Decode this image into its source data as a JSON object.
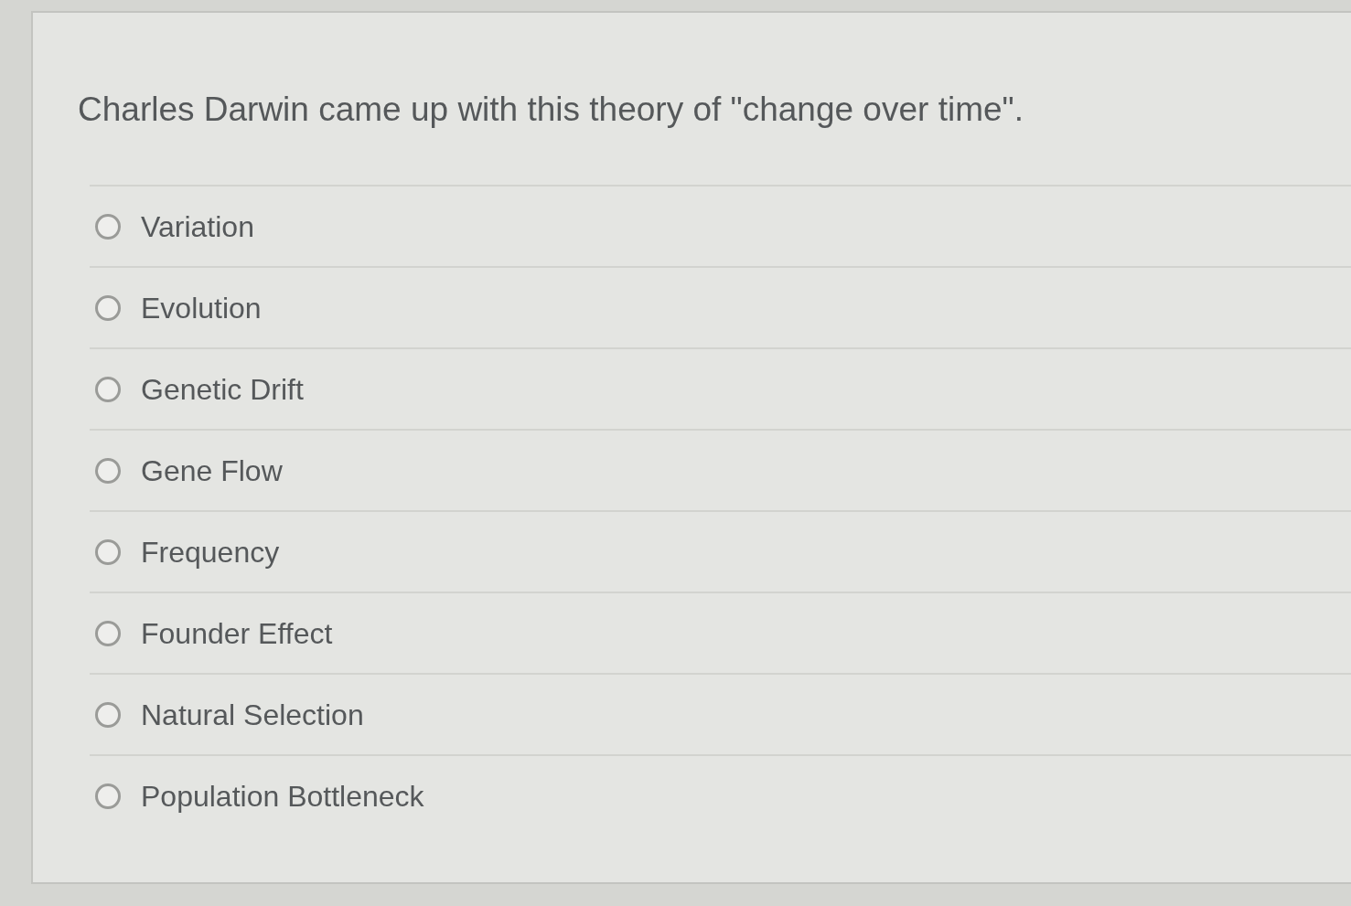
{
  "question": "Charles Darwin came up with this theory of \"change over time\".",
  "options": [
    {
      "label": "Variation",
      "selected": false
    },
    {
      "label": "Evolution",
      "selected": false
    },
    {
      "label": "Genetic Drift",
      "selected": false
    },
    {
      "label": "Gene Flow",
      "selected": false
    },
    {
      "label": "Frequency",
      "selected": false
    },
    {
      "label": "Founder Effect",
      "selected": false
    },
    {
      "label": "Natural Selection",
      "selected": false
    },
    {
      "label": "Population Bottleneck",
      "selected": false
    }
  ]
}
